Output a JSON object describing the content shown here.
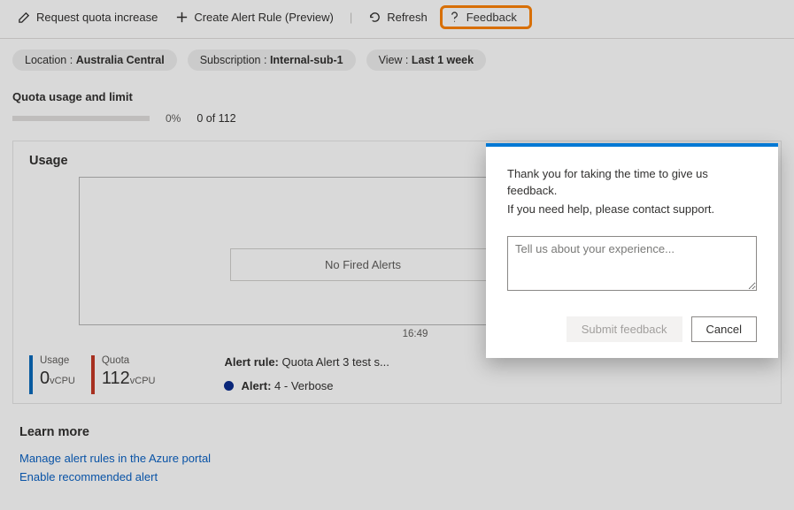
{
  "toolbar": {
    "request_quota": "Request quota increase",
    "create_alert": "Create Alert Rule (Preview)",
    "refresh": "Refresh",
    "feedback": "Feedback"
  },
  "filters": {
    "location_label": "Location : ",
    "location_value": "Australia Central",
    "subscription_label": "Subscription : ",
    "subscription_value": "Internal-sub-1",
    "view_label": "View : ",
    "view_value": "Last 1 week"
  },
  "quota": {
    "title": "Quota usage and limit",
    "percent": "0%",
    "usage_text": "0 of 112"
  },
  "usage": {
    "title": "Usage",
    "no_fired": "No Fired Alerts",
    "axis_time": "16:49",
    "metric_usage_label": "Usage",
    "metric_usage_value": "0",
    "metric_usage_unit": "vCPU",
    "metric_quota_label": "Quota",
    "metric_quota_value": "112",
    "metric_quota_unit": "vCPU",
    "alert_rule_label": "Alert rule:",
    "alert_rule_value": " Quota Alert 3 test s...",
    "alert_label": "Alert:",
    "alert_value": " 4 - Verbose"
  },
  "learn": {
    "title": "Learn more",
    "link1": "Manage alert rules in the Azure portal",
    "link2": "Enable recommended alert"
  },
  "dialog": {
    "line1": "Thank you for taking the time to give us feedback.",
    "line2": "If you need help, please contact support.",
    "placeholder": "Tell us about your experience...",
    "submit": "Submit feedback",
    "cancel": "Cancel"
  }
}
